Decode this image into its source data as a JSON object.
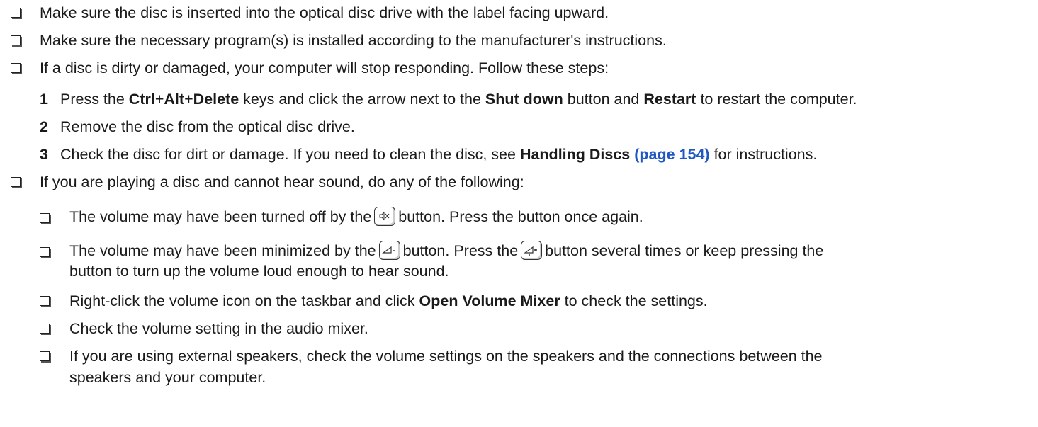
{
  "items": [
    {
      "text": "Make sure the disc is inserted into the optical disc drive with the label facing upward."
    },
    {
      "text": "Make sure the necessary program(s) is installed according to the manufacturer's instructions."
    },
    {
      "text": "If a disc is dirty or damaged, your computer will stop responding. Follow these steps:"
    }
  ],
  "steps": [
    {
      "num": "1",
      "t1": "Press the ",
      "b1": "Ctrl",
      "p1": "+",
      "b2": "Alt",
      "p2": "+",
      "b3": "Delete",
      "t2": " keys and click the arrow next to the ",
      "b4": "Shut down",
      "t3": " button and ",
      "b5": "Restart",
      "t4": " to restart the computer."
    },
    {
      "num": "2",
      "text": "Remove the disc from the optical disc drive."
    },
    {
      "num": "3",
      "t1": "Check the disc for dirt or damage. If you need to clean the disc, see ",
      "b1": "Handling Discs",
      "link": "(page 154)",
      "t2": " for instructions."
    }
  ],
  "sound_intro": "If you are playing a disc and cannot hear sound, do any of the following:",
  "sub": {
    "mute_a": "The volume may have been turned off by the",
    "mute_b": "button. Press the button once again.",
    "min_a": "The volume may have been minimized by the",
    "min_b": "button. Press the",
    "min_c": "button several times or keep pressing the",
    "min_d": "button to turn up the volume loud enough to hear sound.",
    "mixer_a": "Right-click the volume icon on the taskbar and click ",
    "mixer_b": "Open Volume Mixer",
    "mixer_c": " to check the settings.",
    "audio": "Check the volume setting in the audio mixer.",
    "ext_a": "If you are using external speakers, check the volume settings on the speakers and the connections between the",
    "ext_b": "speakers and your computer."
  },
  "icons": {
    "checkbox": "checkbox-icon",
    "mute": "mute-key-icon",
    "volume_down": "volume-down-key-icon",
    "volume_up": "volume-up-key-icon"
  },
  "colors": {
    "link": "#1f57c3"
  }
}
